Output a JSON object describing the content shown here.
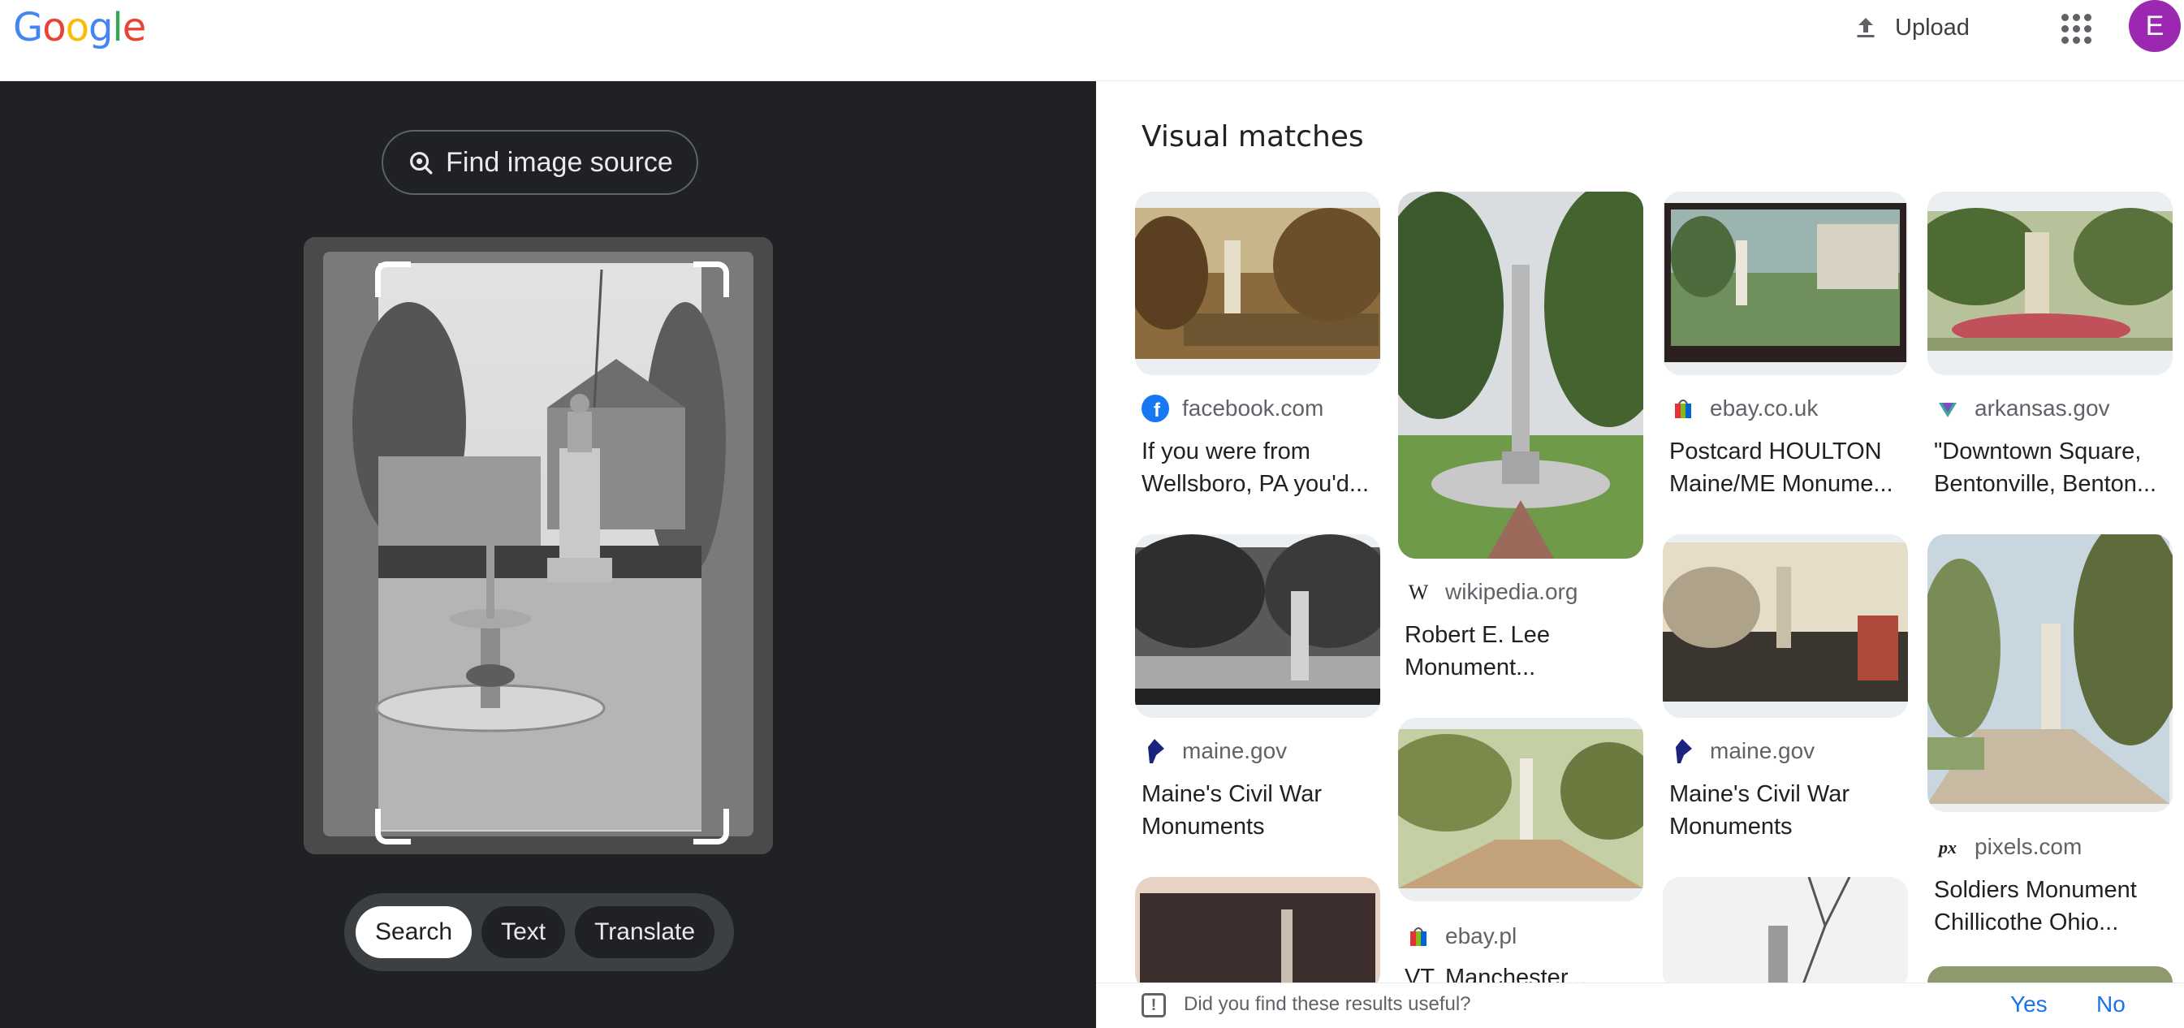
{
  "header": {
    "logo": [
      "G",
      "o",
      "o",
      "g",
      "l",
      "e"
    ],
    "logo_colors": [
      "#4285F4",
      "#EA4335",
      "#FBBC05",
      "#4285F4",
      "#34A853",
      "#EA4335"
    ],
    "upload_label": "Upload",
    "avatar_letter": "E",
    "avatar_color": "#9c27b0"
  },
  "lens": {
    "find_source_label": "Find image source",
    "modes": [
      {
        "label": "Search",
        "active": true
      },
      {
        "label": "Text",
        "active": false
      },
      {
        "label": "Translate",
        "active": false
      }
    ]
  },
  "results": {
    "title": "Visual matches",
    "cards": [
      {
        "source": "facebook.com",
        "icon": "facebook-icon",
        "title": "If you were from Wellsboro, PA you'd...",
        "thumb_style": "sepia"
      },
      {
        "source": "wikipedia.org",
        "icon": "wikipedia-icon",
        "title": "Robert E. Lee Monument...",
        "thumb_style": "color-park"
      },
      {
        "source": "ebay.co.uk",
        "icon": "ebay-icon",
        "title": "Postcard HOULTON Maine/ME Monume...",
        "thumb_style": "postcard-color"
      },
      {
        "source": "arkansas.gov",
        "icon": "arkansas-icon",
        "title": "\"Downtown Square, Bentonville, Benton...",
        "thumb_style": "postcard-green"
      },
      {
        "source": "maine.gov",
        "icon": "maine-icon",
        "title": "Maine's Civil War Monuments",
        "thumb_style": "bw"
      },
      {
        "source": "ebay.pl",
        "icon": "ebay-icon",
        "title": "VT. Manchester...",
        "thumb_style": "postcard-street"
      },
      {
        "source": "maine.gov",
        "icon": "maine-icon",
        "title": "Maine's Civil War Monuments",
        "thumb_style": "crowd"
      },
      {
        "source": "pixels.com",
        "icon": "pixels-icon",
        "title": "Soldiers Monument Chillicothe Ohio...",
        "thumb_style": "postcard-path"
      }
    ]
  },
  "feedback": {
    "question": "Did you find these results useful?",
    "yes": "Yes",
    "no": "No"
  }
}
